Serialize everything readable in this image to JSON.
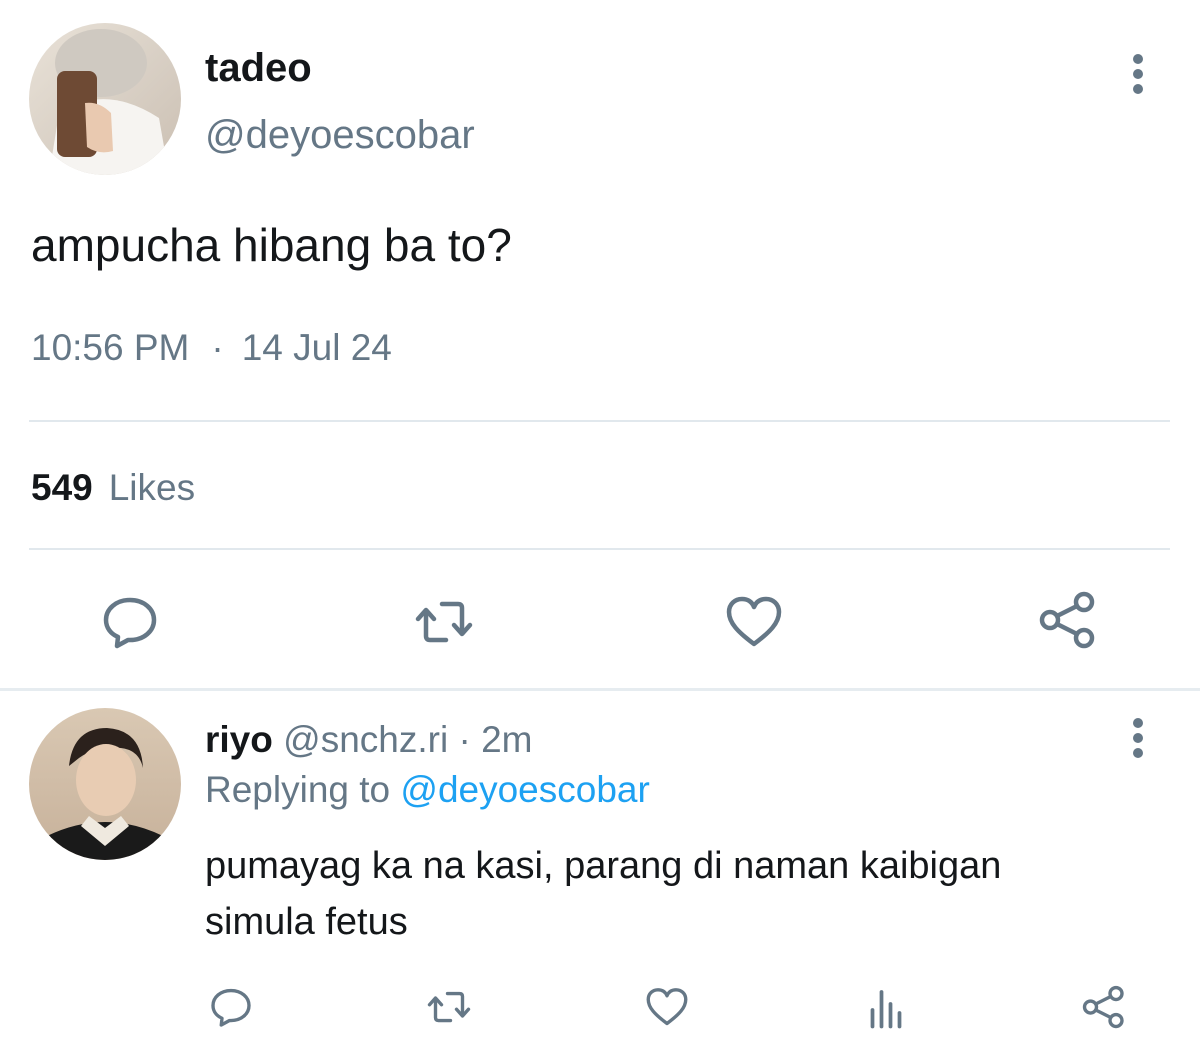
{
  "tweet": {
    "display_name": "tadeo",
    "handle": "@deyoescobar",
    "text": "ampucha hibang ba to?",
    "time": "10:56 PM",
    "separator": "·",
    "date": "14 Jul 24",
    "likes_count": "549",
    "likes_label": "Likes"
  },
  "reply": {
    "display_name": "riyo",
    "handle": "@snchz.ri",
    "separator": "·",
    "age": "2m",
    "replying_prefix": "Replying to",
    "replying_handle": "@deyoescobar",
    "text": "pumayag ka na kasi, parang di naman kaibigan simula fetus"
  },
  "icons": {
    "main_actions": [
      "reply-icon",
      "retweet-icon",
      "like-icon",
      "share-icon"
    ],
    "reply_actions": [
      "reply-icon",
      "retweet-icon",
      "like-icon",
      "analytics-icon",
      "share-icon"
    ],
    "more": "more-vertical-icon"
  },
  "colors": {
    "text_primary": "#14171a",
    "text_secondary": "#657786",
    "link": "#1da1f2",
    "icon": "#657786",
    "divider": "#e1e8ed"
  }
}
